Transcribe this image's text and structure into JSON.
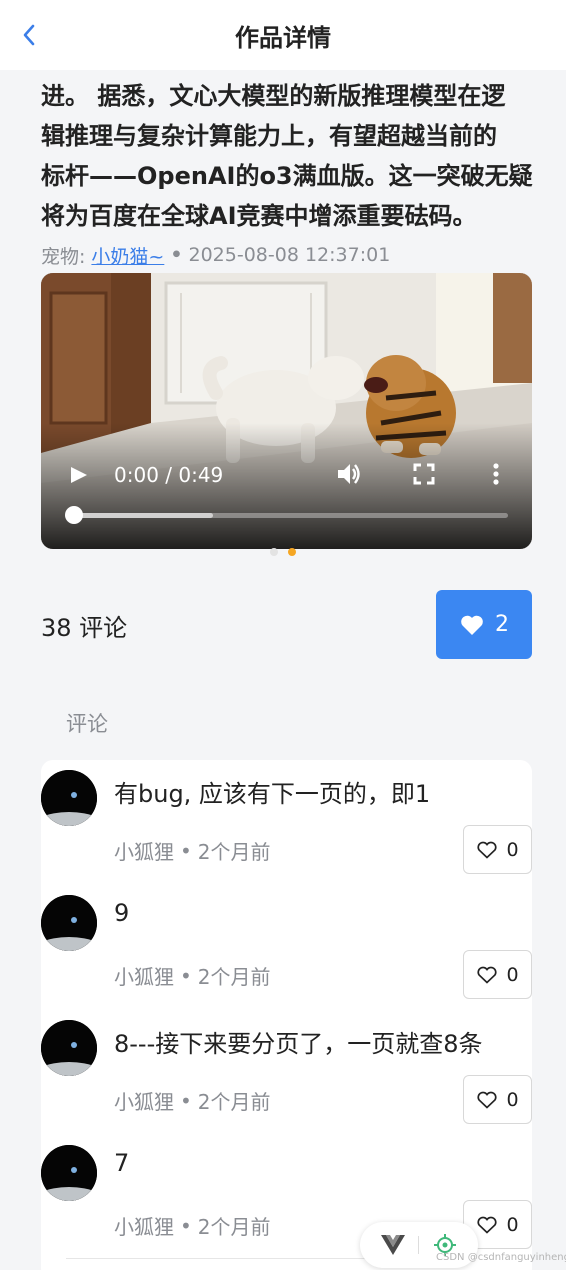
{
  "header": {
    "title": "作品详情"
  },
  "article": {
    "lines": [
      "进。 据悉，文心大模型的新版推理模型在逻",
      "辑推理与复杂计算能力上，有望超越当前的",
      "标杆——OpenAI的o3满血版。这一突破无疑",
      "将为百度在全球AI竞赛中增添重要砝码。"
    ],
    "category_label": "宠物:",
    "author": "小奶猫~",
    "datetime": "2025-08-08 12:37:01"
  },
  "video": {
    "time": "0:00 / 0:49",
    "buffer_fraction": 0.32
  },
  "carousel": {
    "count": 2,
    "active_index": 1
  },
  "stats": {
    "comments": "38 评论",
    "likes": "2"
  },
  "comments_section": {
    "title": "评论",
    "items": [
      {
        "text": "有bug, 应该有下一页的，即1",
        "user": "小狐狸",
        "time": "2个月前",
        "likes": "0"
      },
      {
        "text": "9",
        "user": "小狐狸",
        "time": "2个月前",
        "likes": "0"
      },
      {
        "text": "8---接下来要分页了，一页就查8条",
        "user": "小狐狸",
        "time": "2个月前",
        "likes": "0"
      },
      {
        "text": "7",
        "user": "小狐狸",
        "time": "2个月前",
        "likes": "0"
      }
    ]
  },
  "watermark": "CSDN @csdnfanguyinheng",
  "colors": {
    "accent": "#3b87f2",
    "link": "#3b7ee8",
    "dot_active": "#f5a623"
  }
}
